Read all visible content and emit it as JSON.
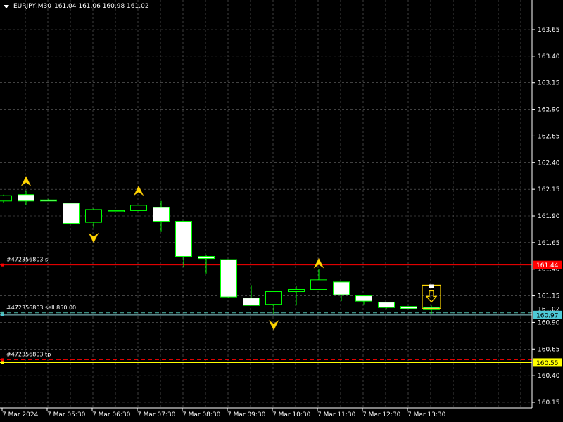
{
  "header": {
    "symbol": "EURJPY,M30",
    "ohlc": "161.04 161.06 160.98 161.02"
  },
  "colors": {
    "background": "#000000",
    "grid": "#c0c0c0",
    "bull_body": "#000000",
    "bear_body": "#ffffff",
    "candle_outline": "#00ff00",
    "sl_line": "#ff0000",
    "tp_line": "#ff0000",
    "entry_line": "#4db8a8",
    "arrow": "#ffd700",
    "bid_label": "#4ec9d6",
    "sl_label": "#ff0000",
    "tp_label": "#ffff00"
  },
  "chart_data": {
    "type": "candlestick",
    "ylim": [
      160.1,
      163.75
    ],
    "grid": true,
    "y_ticks": [
      "163.65",
      "163.40",
      "163.15",
      "162.90",
      "162.65",
      "162.40",
      "162.15",
      "161.90",
      "161.65",
      "161.40",
      "161.15",
      "160.90",
      "160.65",
      "160.40",
      "160.15"
    ],
    "x_ticks": [
      "7 Mar 2024",
      "7 Mar 05:30",
      "7 Mar 06:30",
      "7 Mar 07:30",
      "7 Mar 08:30",
      "7 Mar 09:30",
      "7 Mar 10:30",
      "7 Mar 11:30",
      "7 Mar 12:30",
      "7 Mar 13:30"
    ],
    "candles": [
      {
        "o": 162.04,
        "h": 162.1,
        "c": 162.09,
        "l": 162.02
      },
      {
        "o": 162.1,
        "h": 162.14,
        "c": 162.04,
        "l": 162.0
      },
      {
        "o": 162.05,
        "h": 162.06,
        "c": 162.04,
        "l": 162.04
      },
      {
        "o": 162.02,
        "h": 162.02,
        "c": 161.83,
        "l": 161.83
      },
      {
        "o": 161.84,
        "h": 161.97,
        "c": 161.96,
        "l": 161.79
      },
      {
        "o": 161.94,
        "h": 161.95,
        "c": 161.95,
        "l": 161.94
      },
      {
        "o": 161.95,
        "h": 162.0,
        "c": 162.0,
        "l": 161.95
      },
      {
        "o": 161.98,
        "h": 162.04,
        "c": 161.85,
        "l": 161.75
      },
      {
        "o": 161.85,
        "h": 161.85,
        "c": 161.52,
        "l": 161.42
      },
      {
        "o": 161.52,
        "h": 161.53,
        "c": 161.5,
        "l": 161.36
      },
      {
        "o": 161.49,
        "h": 161.49,
        "c": 161.14,
        "l": 161.13
      },
      {
        "o": 161.13,
        "h": 161.25,
        "c": 161.06,
        "l": 161.06
      },
      {
        "o": 161.07,
        "h": 161.19,
        "c": 161.19,
        "l": 160.98
      },
      {
        "o": 161.19,
        "h": 161.24,
        "c": 161.21,
        "l": 161.06
      },
      {
        "o": 161.21,
        "h": 161.4,
        "c": 161.3,
        "l": 161.2
      },
      {
        "o": 161.28,
        "h": 161.28,
        "c": 161.16,
        "l": 161.1
      },
      {
        "o": 161.15,
        "h": 161.15,
        "c": 161.1,
        "l": 161.07
      },
      {
        "o": 161.09,
        "h": 161.09,
        "c": 161.04,
        "l": 161.02
      },
      {
        "o": 161.05,
        "h": 161.05,
        "c": 161.03,
        "l": 161.03
      },
      {
        "o": 161.04,
        "h": 161.06,
        "c": 161.02,
        "l": 160.98
      }
    ],
    "arrows": [
      {
        "candle": 1,
        "price": 162.22,
        "dir": "up"
      },
      {
        "candle": 4,
        "price": 161.7,
        "dir": "down"
      },
      {
        "candle": 6,
        "price": 162.13,
        "dir": "up"
      },
      {
        "candle": 12,
        "price": 160.88,
        "dir": "down"
      },
      {
        "candle": 14,
        "price": 161.45,
        "dir": "up"
      }
    ],
    "signal_box": {
      "candle": 19,
      "price_top": 161.25,
      "price_bottom": 161.03
    },
    "levels": [
      {
        "label": "#472356803 sl",
        "price": 161.44,
        "price_label": "161.44",
        "color": "#ff0000",
        "style": "solid"
      },
      {
        "label": "#472356803 sell 850.00",
        "price": 160.99,
        "price_label": "",
        "color": "#4db8a8",
        "style": "dashed"
      },
      {
        "label": "#472356803 tp",
        "price": 160.55,
        "price_label": "160.55",
        "color": "#ff0000",
        "style": "dashed"
      }
    ],
    "bid": {
      "price": 160.97,
      "label": "160.97"
    },
    "ask_label": {
      "price": 161.02,
      "label": "161.02"
    }
  }
}
